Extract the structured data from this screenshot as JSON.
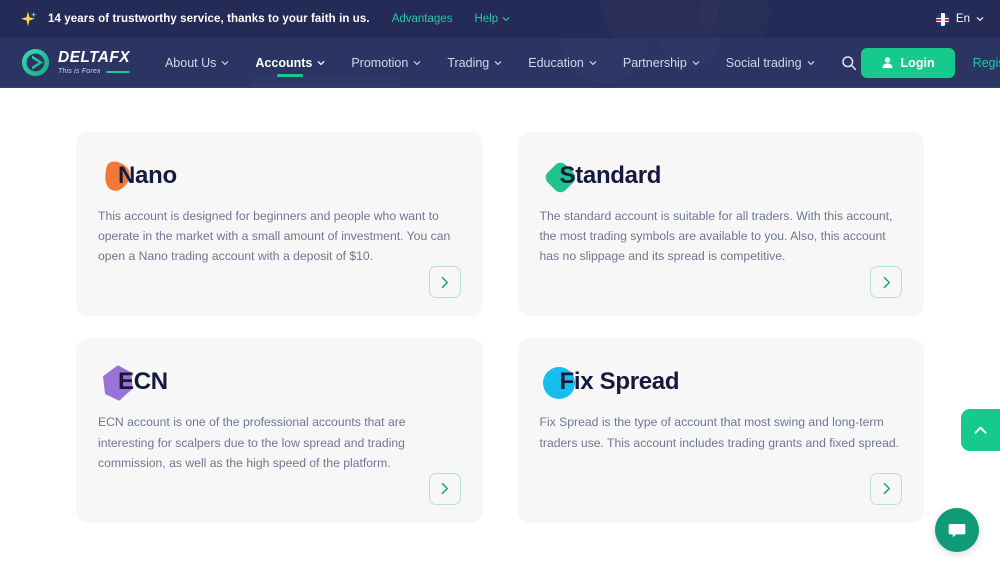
{
  "topbar": {
    "icon": "sparkle-icon",
    "message": "14 years of trustworthy service, thanks to your faith in us.",
    "advantages_label": "Advantages",
    "help_label": "Help",
    "language": "En",
    "flag": "uk-flag-icon"
  },
  "nav": {
    "logo_name": "DELTAFX",
    "logo_tagline": "This is Forex",
    "items": [
      {
        "label": "About Us",
        "active": false,
        "caret": true
      },
      {
        "label": "Accounts",
        "active": true,
        "caret": true
      },
      {
        "label": "Promotion",
        "active": false,
        "caret": true
      },
      {
        "label": "Trading",
        "active": false,
        "caret": true
      },
      {
        "label": "Education",
        "active": false,
        "caret": true
      },
      {
        "label": "Partnership",
        "active": false,
        "caret": true
      },
      {
        "label": "Social trading",
        "active": false,
        "caret": true
      }
    ],
    "search_icon": "search-icon",
    "login_label": "Login",
    "register_label": "Register"
  },
  "cards": [
    {
      "title": "Nano",
      "description": "This account is designed for beginners and people who want to operate in the market with a small amount of investment. You can open a Nano trading account with a deposit of $10.",
      "icon": "nano-blob-icon",
      "color": "#ef7a33",
      "action_icon": "chevron-right-icon"
    },
    {
      "title": "Standard",
      "description": "The standard account is suitable for all traders. With this account, the most trading symbols are available to you. Also, this account has no slippage and its spread is competitive.",
      "icon": "standard-diamond-icon",
      "color": "#1fc38d",
      "action_icon": "chevron-right-icon"
    },
    {
      "title": "ECN",
      "description": "ECN account is one of the professional accounts that are interesting for scalpers due to the low spread and trading commission, as well as the high speed of the platform.",
      "icon": "ecn-hexagon-icon",
      "color": "#9b72d8",
      "action_icon": "chevron-right-icon"
    },
    {
      "title": "Fix Spread",
      "description": "Fix Spread is the type of account that most swing and long-term traders use. This account includes trading grants and fixed spread.",
      "icon": "fixspread-circle-icon",
      "color": "#17bdec",
      "action_icon": "chevron-right-icon"
    }
  ],
  "widgets": {
    "scroll_top_icon": "chevron-up-icon",
    "chat_icon": "chat-bubble-icon"
  },
  "colors": {
    "topbar_bg": "#242b56",
    "nav_bg": "#2b3463",
    "accent_green": "#16c98d",
    "accent_teal": "#2ec6a6",
    "card_bg": "#f7f7f7",
    "title_dark": "#151a3d",
    "body_text": "#6e7792"
  }
}
